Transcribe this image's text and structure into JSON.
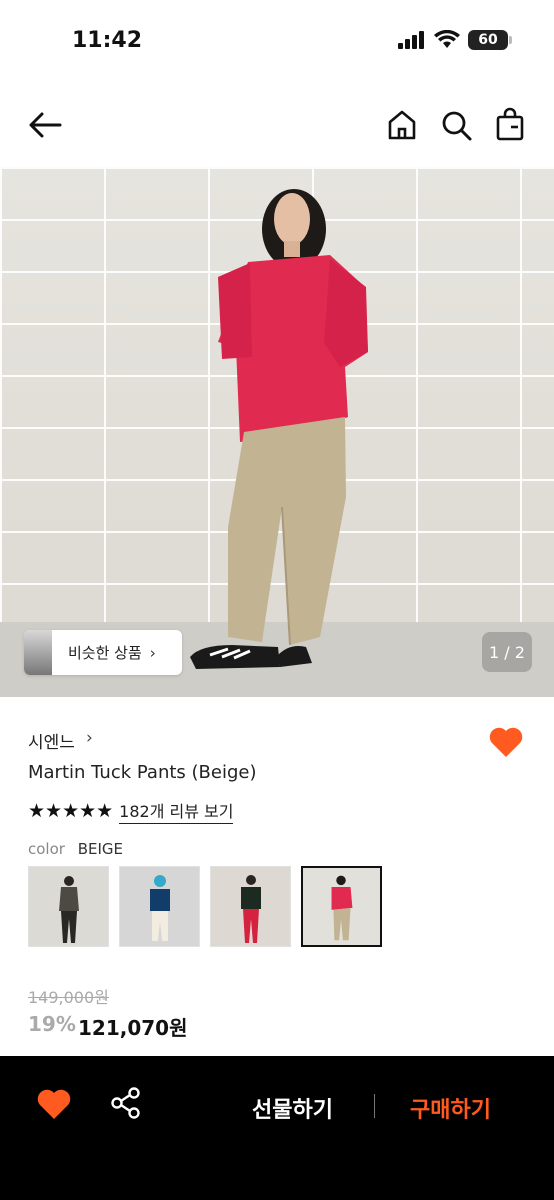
{
  "status_bar": {
    "time": "11:42",
    "battery": "60"
  },
  "header": {
    "icons": [
      "back-arrow-icon",
      "home-icon",
      "search-icon",
      "shopping-bag-icon"
    ]
  },
  "hero": {
    "similar_label": "비슷한 상품",
    "counter": "1 / 2"
  },
  "product": {
    "brand": "시엔느",
    "name": "Martin Tuck Pants (Beige)",
    "rating_stars": "★★★★★",
    "review_link": "182개 리뷰 보기",
    "color_label": "color",
    "color_value": "BEIGE",
    "original_price": "149,000원",
    "discount": "19%",
    "price": "121,070원"
  },
  "colors": {
    "accent": "#ff5a1f",
    "heart": "#ff5a1f"
  },
  "bottom_bar": {
    "gift_label": "선물하기",
    "buy_label": "구매하기"
  }
}
